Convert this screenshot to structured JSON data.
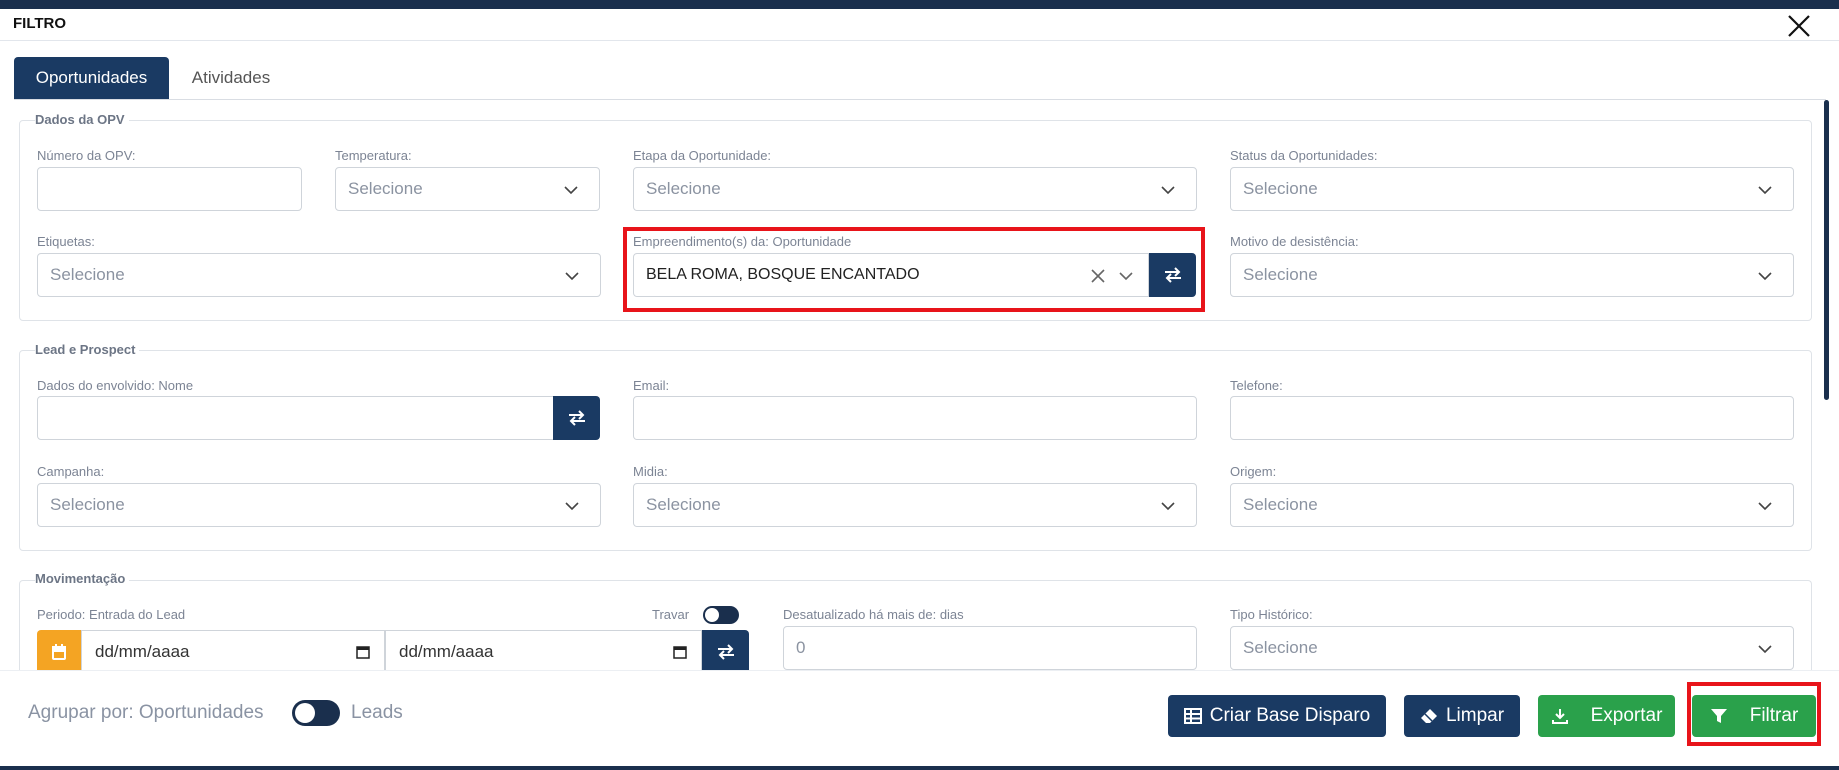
{
  "header": {
    "title": "FILTRO"
  },
  "tabs": [
    {
      "label": "Oportunidades",
      "active": true
    },
    {
      "label": "Atividades",
      "active": false
    }
  ],
  "sections": {
    "dados_opv": {
      "legend": "Dados da OPV",
      "numero_label": "Número da OPV:",
      "temperatura_label": "Temperatura:",
      "temperatura_placeholder": "Selecione",
      "etapa_label": "Etapa da Oportunidade:",
      "etapa_placeholder": "Selecione",
      "status_label": "Status da Oportunidades:",
      "status_placeholder": "Selecione",
      "etiquetas_label": "Etiquetas:",
      "etiquetas_placeholder": "Selecione",
      "empreendimento_label": "Empreendimento(s) da: Oportunidade",
      "empreendimento_value": "BELA ROMA, BOSQUE ENCANTADO",
      "motivo_label": "Motivo de desistência:",
      "motivo_placeholder": "Selecione"
    },
    "lead": {
      "legend": "Lead e Prospect",
      "nome_label": "Dados do envolvido: Nome",
      "email_label": "Email:",
      "telefone_label": "Telefone:",
      "campanha_label": "Campanha:",
      "campanha_placeholder": "Selecione",
      "midia_label": "Midia:",
      "midia_placeholder": "Selecione",
      "origem_label": "Origem:",
      "origem_placeholder": "Selecione"
    },
    "movimentacao": {
      "legend": "Movimentação",
      "periodo_label": "Periodo: Entrada do Lead",
      "travar_label": "Travar",
      "date_from_placeholder": "dd/mm/aaaa",
      "date_to_placeholder": "dd/mm/aaaa",
      "desatualizado_label": "Desatualizado há mais de: dias",
      "desatualizado_value": "0",
      "tipo_historico_label": "Tipo Histórico:",
      "tipo_historico_placeholder": "Selecione"
    }
  },
  "footer": {
    "agrupar_label": "Agrupar por: Oportunidades",
    "leads_label": "Leads",
    "criar_base_label": "Criar Base Disparo",
    "limpar_label": "Limpar",
    "exportar_label": "Exportar",
    "filtrar_label": "Filtrar"
  },
  "colors": {
    "navy": "#1a3a63",
    "green": "#2aa14b",
    "orange": "#f4a423",
    "highlight": "#e8141a"
  }
}
